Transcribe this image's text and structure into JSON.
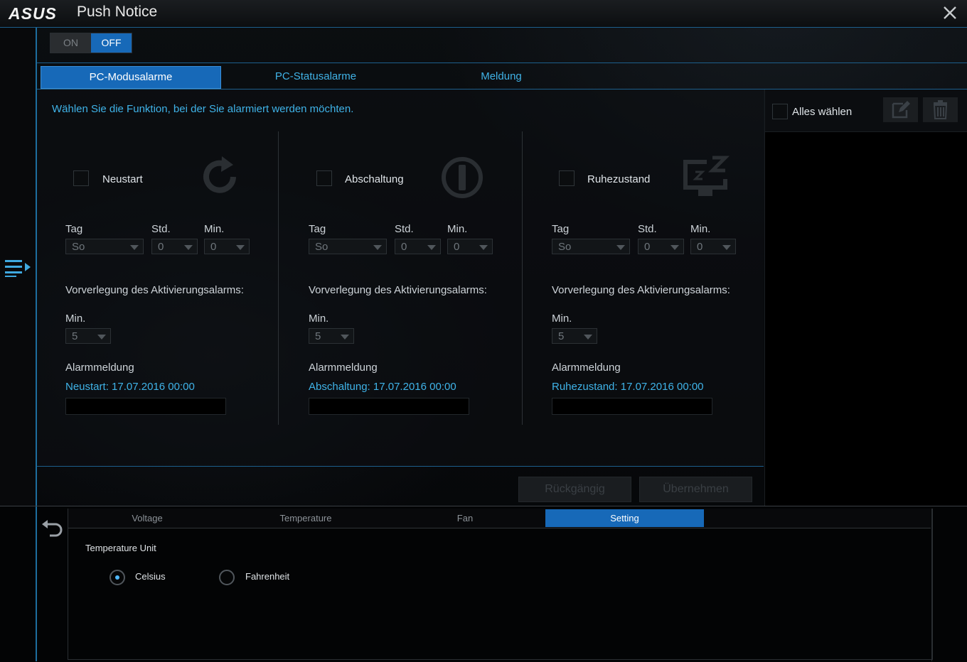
{
  "app": {
    "logo": "ASUS",
    "title": "Push Notice"
  },
  "toggle": {
    "on_label": "ON",
    "off_label": "OFF",
    "selected": "OFF"
  },
  "tabs": [
    {
      "label": "PC-Modusalarme",
      "active": true
    },
    {
      "label": "PC-Statusalarme",
      "active": false
    },
    {
      "label": "Meldung",
      "active": false
    }
  ],
  "instruction": "Wählen Sie die Funktion, bei der Sie alarmiert werden möchten.",
  "columns": [
    {
      "name": "Neustart",
      "icon": "restart-icon",
      "tag_label": "Tag",
      "std_label": "Std.",
      "min_label": "Min.",
      "tag_value": "So",
      "std_value": "0",
      "min_value": "0",
      "advance_label": "Vorverlegung des Aktivierungsalarms:",
      "advance_min_label": "Min.",
      "advance_min_value": "5",
      "alarm_label": "Alarmmeldung",
      "alarm_text": "Neustart: 17.07.2016 00:00"
    },
    {
      "name": "Abschaltung",
      "icon": "power-icon",
      "tag_label": "Tag",
      "std_label": "Std.",
      "min_label": "Min.",
      "tag_value": "So",
      "std_value": "0",
      "min_value": "0",
      "advance_label": "Vorverlegung des Aktivierungsalarms:",
      "advance_min_label": "Min.",
      "advance_min_value": "5",
      "alarm_label": "Alarmmeldung",
      "alarm_text": "Abschaltung: 17.07.2016 00:00"
    },
    {
      "name": "Ruhezustand",
      "icon": "sleep-icon",
      "tag_label": "Tag",
      "std_label": "Std.",
      "min_label": "Min.",
      "tag_value": "So",
      "std_value": "0",
      "min_value": "0",
      "advance_label": "Vorverlegung des Aktivierungsalarms:",
      "advance_min_label": "Min.",
      "advance_min_value": "5",
      "alarm_label": "Alarmmeldung",
      "alarm_text": "Ruhezustand: 17.07.2016 00:00"
    }
  ],
  "actions": {
    "undo_label": "Rückgängig",
    "apply_label": "Übernehmen"
  },
  "right_panel": {
    "select_all_label": "Alles wählen",
    "edit_icon": "edit-icon",
    "delete_icon": "trash-icon"
  },
  "bottom": {
    "tabs": [
      {
        "label": "Voltage",
        "active": false
      },
      {
        "label": "Temperature",
        "active": false
      },
      {
        "label": "Fan",
        "active": false
      },
      {
        "label": "Setting",
        "active": true
      }
    ],
    "temperature_unit_label": "Temperature Unit",
    "options": [
      {
        "label": "Celsius",
        "selected": true
      },
      {
        "label": "Fahrenheit",
        "selected": false
      }
    ]
  },
  "colors": {
    "accent": "#1769b8",
    "highlight_text": "#3fb3e8",
    "border_blue": "#1d5f8c"
  }
}
